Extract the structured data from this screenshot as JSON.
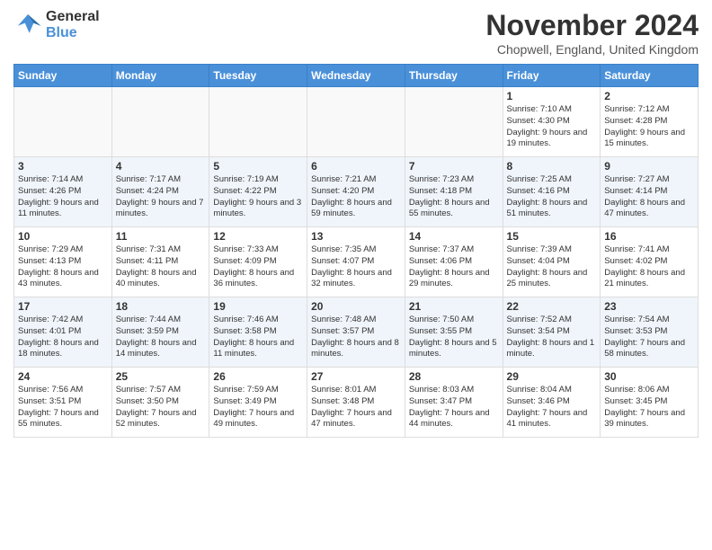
{
  "header": {
    "logo_line1": "General",
    "logo_line2": "Blue",
    "month_title": "November 2024",
    "subtitle": "Chopwell, England, United Kingdom"
  },
  "days_of_week": [
    "Sunday",
    "Monday",
    "Tuesday",
    "Wednesday",
    "Thursday",
    "Friday",
    "Saturday"
  ],
  "weeks": [
    [
      {
        "day": "",
        "info": ""
      },
      {
        "day": "",
        "info": ""
      },
      {
        "day": "",
        "info": ""
      },
      {
        "day": "",
        "info": ""
      },
      {
        "day": "",
        "info": ""
      },
      {
        "day": "1",
        "info": "Sunrise: 7:10 AM\nSunset: 4:30 PM\nDaylight: 9 hours and 19 minutes."
      },
      {
        "day": "2",
        "info": "Sunrise: 7:12 AM\nSunset: 4:28 PM\nDaylight: 9 hours and 15 minutes."
      }
    ],
    [
      {
        "day": "3",
        "info": "Sunrise: 7:14 AM\nSunset: 4:26 PM\nDaylight: 9 hours and 11 minutes."
      },
      {
        "day": "4",
        "info": "Sunrise: 7:17 AM\nSunset: 4:24 PM\nDaylight: 9 hours and 7 minutes."
      },
      {
        "day": "5",
        "info": "Sunrise: 7:19 AM\nSunset: 4:22 PM\nDaylight: 9 hours and 3 minutes."
      },
      {
        "day": "6",
        "info": "Sunrise: 7:21 AM\nSunset: 4:20 PM\nDaylight: 8 hours and 59 minutes."
      },
      {
        "day": "7",
        "info": "Sunrise: 7:23 AM\nSunset: 4:18 PM\nDaylight: 8 hours and 55 minutes."
      },
      {
        "day": "8",
        "info": "Sunrise: 7:25 AM\nSunset: 4:16 PM\nDaylight: 8 hours and 51 minutes."
      },
      {
        "day": "9",
        "info": "Sunrise: 7:27 AM\nSunset: 4:14 PM\nDaylight: 8 hours and 47 minutes."
      }
    ],
    [
      {
        "day": "10",
        "info": "Sunrise: 7:29 AM\nSunset: 4:13 PM\nDaylight: 8 hours and 43 minutes."
      },
      {
        "day": "11",
        "info": "Sunrise: 7:31 AM\nSunset: 4:11 PM\nDaylight: 8 hours and 40 minutes."
      },
      {
        "day": "12",
        "info": "Sunrise: 7:33 AM\nSunset: 4:09 PM\nDaylight: 8 hours and 36 minutes."
      },
      {
        "day": "13",
        "info": "Sunrise: 7:35 AM\nSunset: 4:07 PM\nDaylight: 8 hours and 32 minutes."
      },
      {
        "day": "14",
        "info": "Sunrise: 7:37 AM\nSunset: 4:06 PM\nDaylight: 8 hours and 29 minutes."
      },
      {
        "day": "15",
        "info": "Sunrise: 7:39 AM\nSunset: 4:04 PM\nDaylight: 8 hours and 25 minutes."
      },
      {
        "day": "16",
        "info": "Sunrise: 7:41 AM\nSunset: 4:02 PM\nDaylight: 8 hours and 21 minutes."
      }
    ],
    [
      {
        "day": "17",
        "info": "Sunrise: 7:42 AM\nSunset: 4:01 PM\nDaylight: 8 hours and 18 minutes."
      },
      {
        "day": "18",
        "info": "Sunrise: 7:44 AM\nSunset: 3:59 PM\nDaylight: 8 hours and 14 minutes."
      },
      {
        "day": "19",
        "info": "Sunrise: 7:46 AM\nSunset: 3:58 PM\nDaylight: 8 hours and 11 minutes."
      },
      {
        "day": "20",
        "info": "Sunrise: 7:48 AM\nSunset: 3:57 PM\nDaylight: 8 hours and 8 minutes."
      },
      {
        "day": "21",
        "info": "Sunrise: 7:50 AM\nSunset: 3:55 PM\nDaylight: 8 hours and 5 minutes."
      },
      {
        "day": "22",
        "info": "Sunrise: 7:52 AM\nSunset: 3:54 PM\nDaylight: 8 hours and 1 minute."
      },
      {
        "day": "23",
        "info": "Sunrise: 7:54 AM\nSunset: 3:53 PM\nDaylight: 7 hours and 58 minutes."
      }
    ],
    [
      {
        "day": "24",
        "info": "Sunrise: 7:56 AM\nSunset: 3:51 PM\nDaylight: 7 hours and 55 minutes."
      },
      {
        "day": "25",
        "info": "Sunrise: 7:57 AM\nSunset: 3:50 PM\nDaylight: 7 hours and 52 minutes."
      },
      {
        "day": "26",
        "info": "Sunrise: 7:59 AM\nSunset: 3:49 PM\nDaylight: 7 hours and 49 minutes."
      },
      {
        "day": "27",
        "info": "Sunrise: 8:01 AM\nSunset: 3:48 PM\nDaylight: 7 hours and 47 minutes."
      },
      {
        "day": "28",
        "info": "Sunrise: 8:03 AM\nSunset: 3:47 PM\nDaylight: 7 hours and 44 minutes."
      },
      {
        "day": "29",
        "info": "Sunrise: 8:04 AM\nSunset: 3:46 PM\nDaylight: 7 hours and 41 minutes."
      },
      {
        "day": "30",
        "info": "Sunrise: 8:06 AM\nSunset: 3:45 PM\nDaylight: 7 hours and 39 minutes."
      }
    ]
  ]
}
